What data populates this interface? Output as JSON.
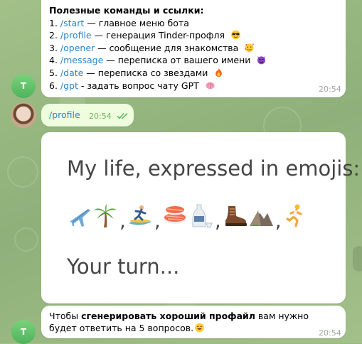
{
  "messages": {
    "commands": {
      "title": "Полезные команды и ссылки:",
      "items": [
        {
          "num": "1.",
          "command": "/start",
          "description": " — главное меню бота",
          "icon": "none"
        },
        {
          "num": "2.",
          "command": "/profile",
          "description": " — генерация Tinder-профля",
          "icon": "sunglasses-emoji-icon"
        },
        {
          "num": "3.",
          "command": "/opener",
          "description": " — сообщение для знакомства",
          "icon": "hearts-face-emoji-icon"
        },
        {
          "num": "4.",
          "command": "/message",
          "description": " — переписка от вашего имени",
          "icon": "devil-emoji-icon"
        },
        {
          "num": "5.",
          "command": "/date",
          "description": " — переписка со звездами",
          "icon": "fire-emoji-icon"
        },
        {
          "num": "6.",
          "command": "/gpt",
          "description": " - задать вопрос чату GPT",
          "icon": "brain-emoji-icon"
        }
      ],
      "time": "20:54",
      "avatar_letter": "T"
    },
    "outgoing": {
      "text": "/profile",
      "time": "20:54"
    },
    "image": {
      "title": "My life, expressed in emojis:",
      "footer": "Your turn..."
    },
    "bottom": {
      "text_part1": "Чтобы ",
      "text_bold": "сгенерировать хороший профайл",
      "text_part2": " вам нужно будет ответить на 5 вопросов.",
      "time": "20:54",
      "avatar_letter": "T"
    }
  },
  "colors": {
    "link": "#2f84c8",
    "outgoing_bg": "#effddf",
    "avatar_green": "#4fb35d",
    "read_check": "#4fae4e"
  }
}
